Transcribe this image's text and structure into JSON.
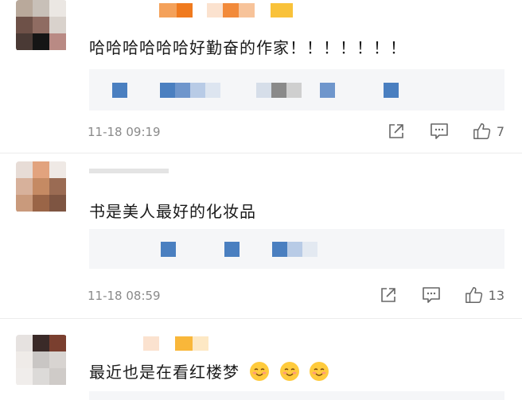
{
  "comments": [
    {
      "text": "哈哈哈哈哈哈好勤奋的作家！！！！！！！",
      "time": "11-18 09:19",
      "likes": "7",
      "emoji_count": 0
    },
    {
      "text": "书是美人最好的化妆品",
      "time": "11-18 08:59",
      "likes": "13",
      "emoji_count": 0
    },
    {
      "text": "最近也是在看红楼梦",
      "emoji_count": 3,
      "emoji": "smiling-face-emoji"
    }
  ],
  "icons": {
    "share": "share-icon",
    "comment": "comment-icon",
    "like": "thumbs-up-icon"
  },
  "colors": {
    "quote_bg": "#f5f6f8",
    "meta_text": "#8a8a8a",
    "accent_blue": "#4a7fc0",
    "accent_orange": "#f07a1e"
  }
}
